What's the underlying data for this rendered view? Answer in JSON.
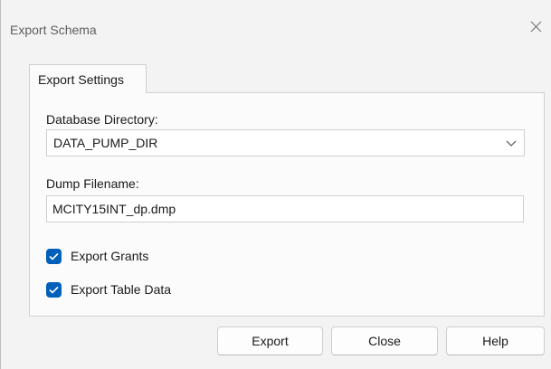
{
  "window": {
    "title": "Export Schema"
  },
  "tabs": [
    {
      "label": "Export Settings",
      "selected": true
    }
  ],
  "form": {
    "database_directory_label": "Database Directory:",
    "database_directory_value": "DATA_PUMP_DIR",
    "dump_filename_label": "Dump Filename:",
    "dump_filename_value": "MCITY15INT_dp.dmp"
  },
  "checkboxes": [
    {
      "label": "Export Grants",
      "checked": true
    },
    {
      "label": "Export Table Data",
      "checked": true
    }
  ],
  "buttons": {
    "export": "Export",
    "close": "Close",
    "help": "Help"
  },
  "colors": {
    "accent": "#005fb8",
    "window_bg": "#f3f3f3",
    "panel_bg": "#fbfbfb"
  },
  "icons": {
    "close": "close-icon",
    "dropdown": "chevron-down-icon",
    "check": "checkmark-icon"
  }
}
